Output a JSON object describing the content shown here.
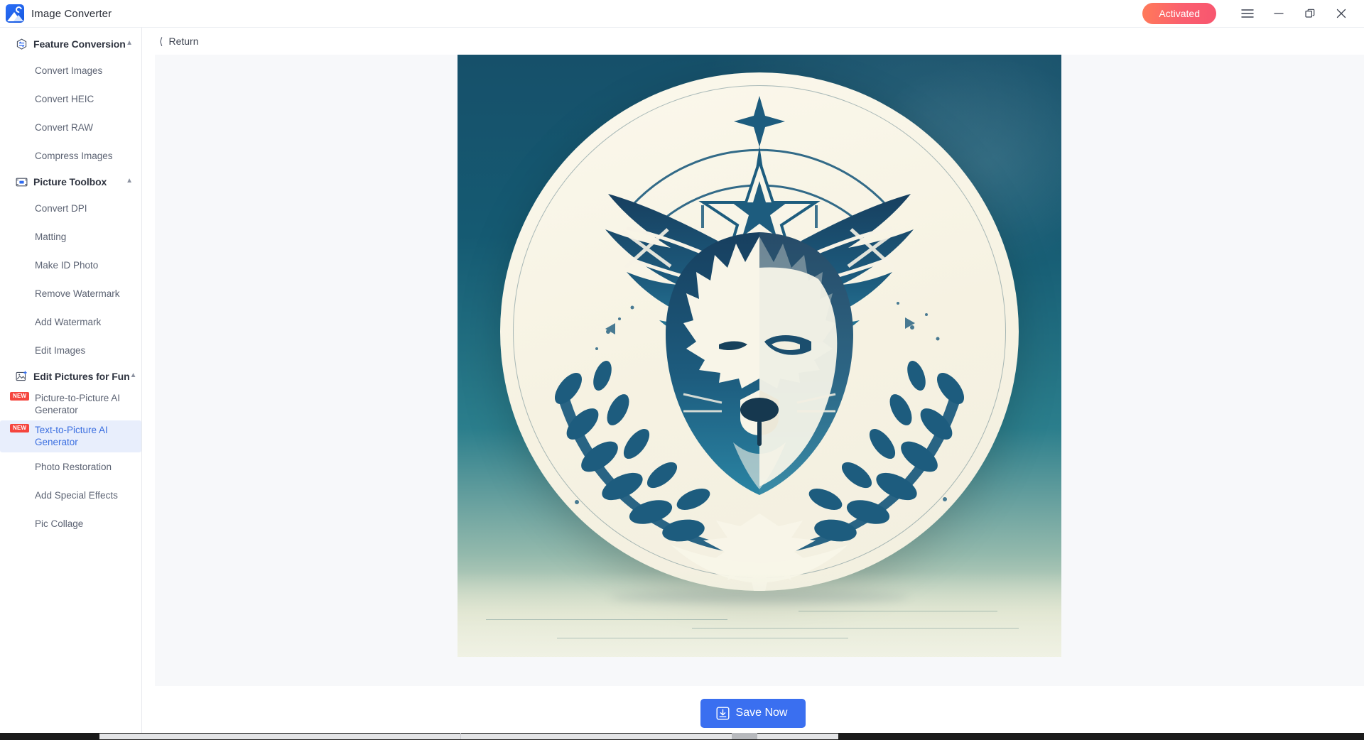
{
  "window": {
    "app_title": "Image Converter",
    "logo_icon": "image-converter-logo-icon",
    "activated_label": "Activated",
    "menu_icon": "hamburger-menu-icon",
    "minimize_icon": "minimize-icon",
    "maximize_icon": "maximize-restore-icon",
    "close_icon": "close-icon"
  },
  "sidebar": {
    "groups": [
      {
        "label": "Feature Conversion",
        "icon": "feature-conversion-icon",
        "chevron": "chevron-up-icon",
        "expanded": true,
        "items": [
          {
            "label": "Convert Images",
            "badge": "",
            "active": false
          },
          {
            "label": "Convert HEIC",
            "badge": "",
            "active": false
          },
          {
            "label": "Convert RAW",
            "badge": "",
            "active": false
          },
          {
            "label": "Compress Images",
            "badge": "",
            "active": false
          }
        ]
      },
      {
        "label": "Picture Toolbox",
        "icon": "picture-toolbox-icon",
        "chevron": "chevron-up-icon",
        "expanded": true,
        "items": [
          {
            "label": "Convert DPI",
            "badge": "",
            "active": false
          },
          {
            "label": "Matting",
            "badge": "",
            "active": false
          },
          {
            "label": "Make ID Photo",
            "badge": "",
            "active": false
          },
          {
            "label": "Remove Watermark",
            "badge": "",
            "active": false
          },
          {
            "label": "Add Watermark",
            "badge": "",
            "active": false
          },
          {
            "label": "Edit Images",
            "badge": "",
            "active": false
          }
        ]
      },
      {
        "label": "Edit Pictures for Fun",
        "icon": "edit-pictures-for-fun-icon",
        "chevron": "chevron-up-icon",
        "expanded": true,
        "items": [
          {
            "label": "Picture-to-Picture AI Generator",
            "badge": "NEW",
            "active": false
          },
          {
            "label": "Text-to-Picture AI Generator",
            "badge": "NEW",
            "active": true
          },
          {
            "label": "Photo Restoration",
            "badge": "",
            "active": false
          },
          {
            "label": "Add Special Effects",
            "badge": "",
            "active": false
          },
          {
            "label": "Pic Collage",
            "badge": "",
            "active": false
          }
        ]
      }
    ]
  },
  "content": {
    "return_label": "Return",
    "return_icon": "chevron-left-icon",
    "preview": {
      "name": "generated-image-preview",
      "description": "AI generated emblem: white wolf head with spread wings, laurel wreath and a star inside a cream circular disc on a teal gradient background"
    },
    "save_button": {
      "label": "Save Now",
      "icon": "download-icon"
    }
  },
  "colors": {
    "accent_blue": "#3a6ff0",
    "activated_gradient_start": "#ff7a59",
    "activated_gradient_end": "#f8566f",
    "badge_red": "#f5453e",
    "active_item_bg": "#e8eefc",
    "active_item_text": "#3a6ee0",
    "sidebar_text": "#5c6373",
    "stage_bg": "#f7f8fa",
    "art_teal": "#16506a",
    "art_cream": "#faf7eb"
  }
}
